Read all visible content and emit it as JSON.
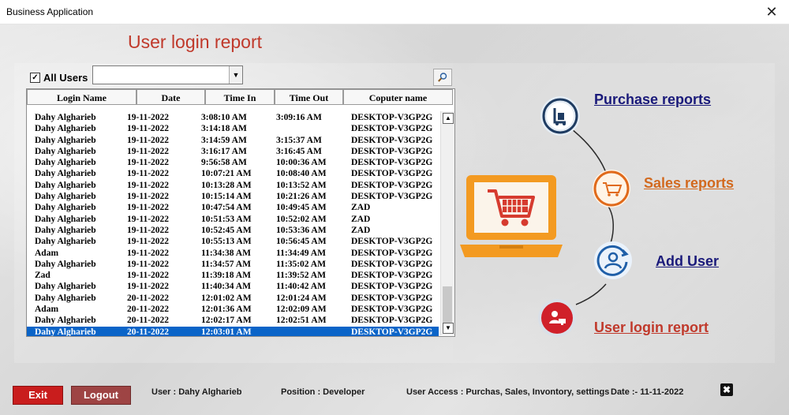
{
  "window": {
    "title": "Business Application",
    "close_glyph": "✕"
  },
  "report": {
    "title": "User login report"
  },
  "filter": {
    "all_users_label": "All Users",
    "all_users_checked": true,
    "user_select_value": ""
  },
  "table": {
    "columns": [
      "Login Name",
      "Date",
      "Time In",
      "Time Out",
      "Coputer name"
    ],
    "rows": [
      [
        "Dahy Algharieb",
        "19-11-2022",
        "3:08:10 AM",
        "3:09:16 AM",
        "DESKTOP-V3GP2G"
      ],
      [
        "Dahy Algharieb",
        "19-11-2022",
        "3:14:18 AM",
        "",
        "DESKTOP-V3GP2G"
      ],
      [
        "Dahy Algharieb",
        "19-11-2022",
        "3:14:59 AM",
        "3:15:37 AM",
        "DESKTOP-V3GP2G"
      ],
      [
        "Dahy Algharieb",
        "19-11-2022",
        "3:16:17 AM",
        "3:16:45 AM",
        "DESKTOP-V3GP2G"
      ],
      [
        "Dahy Algharieb",
        "19-11-2022",
        "9:56:58 AM",
        "10:00:36 AM",
        "DESKTOP-V3GP2G"
      ],
      [
        "Dahy Algharieb",
        "19-11-2022",
        "10:07:21 AM",
        "10:08:40 AM",
        "DESKTOP-V3GP2G"
      ],
      [
        "Dahy Algharieb",
        "19-11-2022",
        "10:13:28 AM",
        "10:13:52 AM",
        "DESKTOP-V3GP2G"
      ],
      [
        "Dahy Algharieb",
        "19-11-2022",
        "10:15:14 AM",
        "10:21:26 AM",
        "DESKTOP-V3GP2G"
      ],
      [
        "Dahy Algharieb",
        "19-11-2022",
        "10:47:54 AM",
        "10:49:45 AM",
        "ZAD"
      ],
      [
        "Dahy Algharieb",
        "19-11-2022",
        "10:51:53 AM",
        "10:52:02 AM",
        "ZAD"
      ],
      [
        "Dahy Algharieb",
        "19-11-2022",
        "10:52:45 AM",
        "10:53:36 AM",
        "ZAD"
      ],
      [
        "Dahy Algharieb",
        "19-11-2022",
        "10:55:13 AM",
        "10:56:45 AM",
        "DESKTOP-V3GP2G"
      ],
      [
        "Adam",
        "19-11-2022",
        "11:34:38 AM",
        "11:34:49 AM",
        "DESKTOP-V3GP2G"
      ],
      [
        "Dahy Algharieb",
        "19-11-2022",
        "11:34:57 AM",
        "11:35:02 AM",
        "DESKTOP-V3GP2G"
      ],
      [
        "Zad",
        "19-11-2022",
        "11:39:18 AM",
        "11:39:52 AM",
        "DESKTOP-V3GP2G"
      ],
      [
        "Dahy Algharieb",
        "19-11-2022",
        "11:40:34 AM",
        "11:40:42 AM",
        "DESKTOP-V3GP2G"
      ],
      [
        "Dahy Algharieb",
        "20-11-2022",
        "12:01:02 AM",
        "12:01:24 AM",
        "DESKTOP-V3GP2G"
      ],
      [
        "Adam",
        "20-11-2022",
        "12:01:36 AM",
        "12:02:09 AM",
        "DESKTOP-V3GP2G"
      ],
      [
        "Dahy Algharieb",
        "20-11-2022",
        "12:02:17 AM",
        "12:02:51 AM",
        "DESKTOP-V3GP2G"
      ],
      [
        "Dahy Algharieb",
        "20-11-2022",
        "12:03:01 AM",
        "",
        "DESKTOP-V3GP2G"
      ]
    ],
    "selected_row_index": 19
  },
  "menu": {
    "purchase": "Purchase reports",
    "sales": "Sales reports",
    "add_user": "Add User",
    "login_report": "User login report"
  },
  "footer": {
    "exit_label": "Exit",
    "logout_label": "Logout",
    "user_text": "User : Dahy Algharieb",
    "position_text": "Position : Developer",
    "access_text": "User Access : Purchas, Sales, Invontory, settings",
    "date_text": "Date :-  11-11-2022",
    "close_glyph": "✖"
  },
  "colors": {
    "purchase_link": "#1a1a7a",
    "sales_link": "#d2691e",
    "add_user_link": "#1a1a7a",
    "login_report_link": "#c0392b",
    "selection": "#0a64c8",
    "laptop_orange": "#f39a21",
    "cart_red": "#d63b2f"
  }
}
